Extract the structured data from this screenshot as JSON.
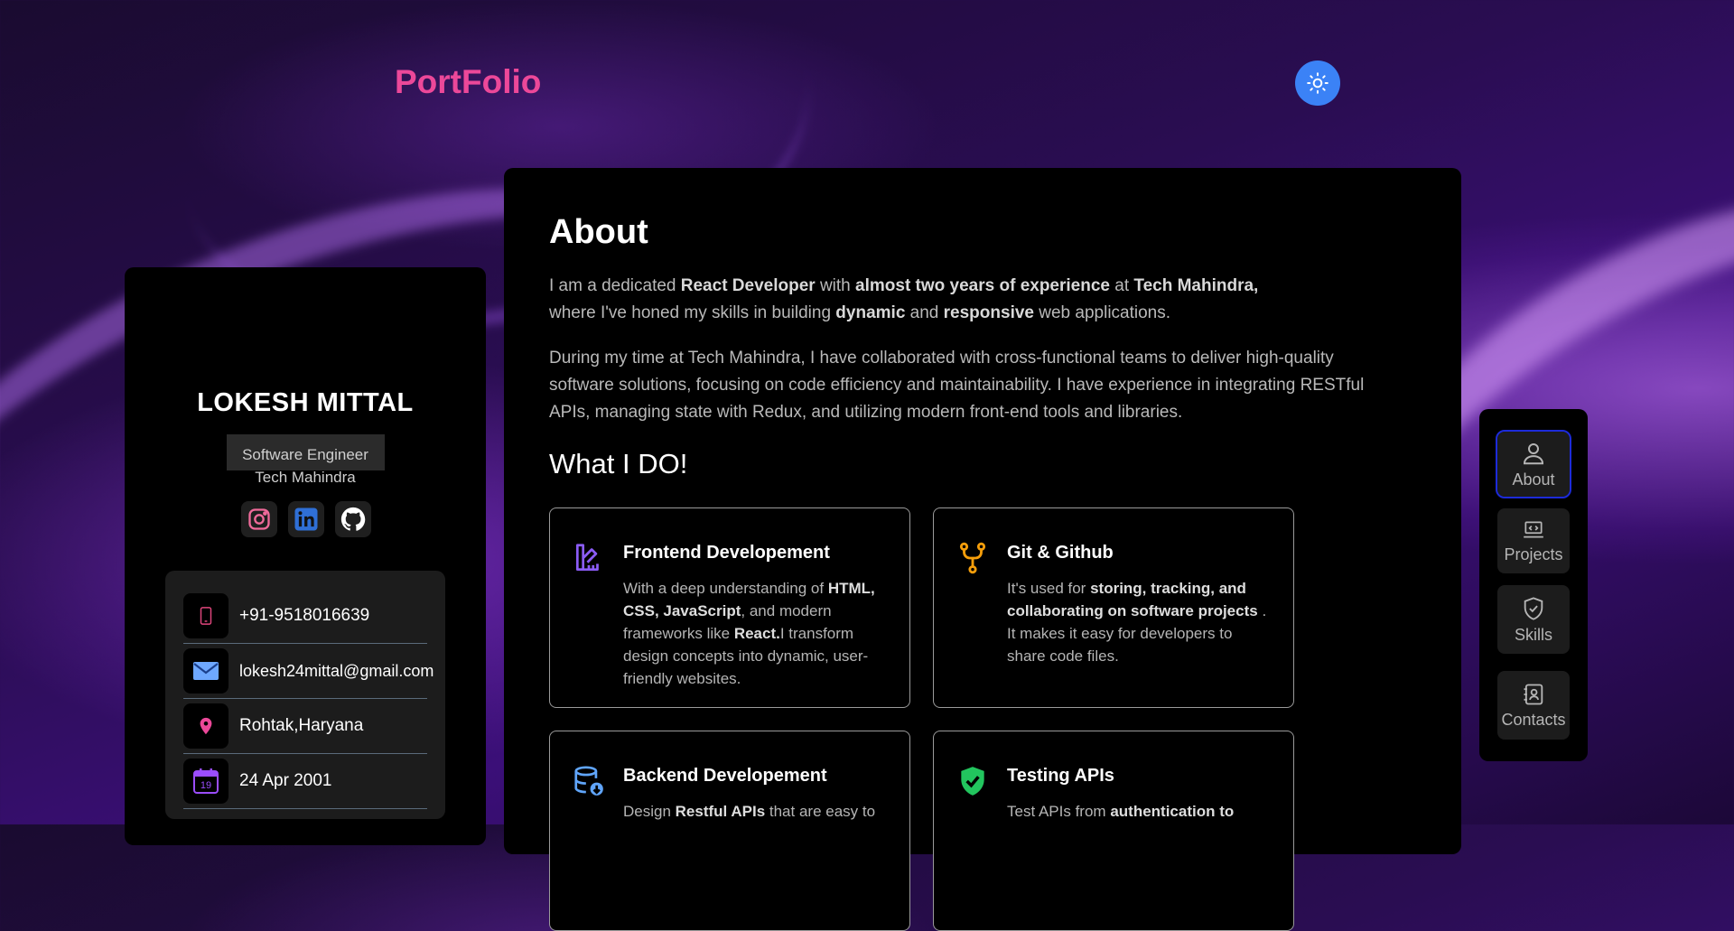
{
  "header": {
    "logo": "PortFolio",
    "theme_toggle_icon": "sun-icon"
  },
  "profile": {
    "name": "LOKESH MITTAL",
    "role": "Software Engineer",
    "company": "Tech Mahindra",
    "socials": [
      "instagram-icon",
      "linkedin-icon",
      "github-icon"
    ],
    "contacts": [
      {
        "icon": "phone-icon",
        "value": "+91-9518016639"
      },
      {
        "icon": "mail-icon",
        "value": "lokesh24mittal@gmail.com"
      },
      {
        "icon": "location-icon",
        "value": "Rohtak,Haryana"
      },
      {
        "icon": "calendar-icon",
        "value": "24 Apr 2001",
        "calendar_day": "19"
      }
    ]
  },
  "about": {
    "title": "About",
    "p1": {
      "t1": "I am a dedicated ",
      "b1": "React Developer",
      "t2": " with ",
      "b2": "almost two years of experience",
      "t3": " at ",
      "b3": "Tech Mahindra,",
      "t4": "where I've honed my skills in building ",
      "b4": "dynamic",
      "t5": " and ",
      "b5": "responsive",
      "t6": " web applications."
    },
    "p2": "During my time at Tech Mahindra, I have collaborated with cross-functional teams to deliver high-quality software solutions, focusing on code efficiency and maintainability. I have experience in integrating RESTful APIs, managing state with Redux, and utilizing modern front-end tools and libraries.",
    "what_title": "What I DO!",
    "cards": [
      {
        "title": "Frontend Developement",
        "t1": "With a deep understanding of ",
        "b1": "HTML, CSS, JavaScript",
        "t2": ", and modern frameworks like ",
        "b2": "React.",
        "t3": "I transform design concepts into dynamic, user-friendly websites."
      },
      {
        "title": "Git & Github",
        "t1": "It's used for ",
        "b1": "storing, tracking, and collaborating on software projects",
        "t2": " . It makes it easy for developers to share code files."
      },
      {
        "title": "Backend Developement",
        "t1": "Design ",
        "b1": "Restful APIs",
        "t2": " that are easy to"
      },
      {
        "title": "Testing APIs",
        "t1": "Test APIs from ",
        "b1": "authentication to"
      }
    ]
  },
  "nav": {
    "items": [
      {
        "label": "About",
        "icon": "user-icon",
        "active": true
      },
      {
        "label": "Projects",
        "icon": "laptop-code-icon"
      },
      {
        "label": "Skills",
        "icon": "shield-check-icon"
      },
      {
        "label": "Contacts",
        "icon": "contact-book-icon"
      }
    ]
  },
  "colors": {
    "accent_pink": "#ec4899",
    "theme_button": "#3b82f6",
    "panel": "#000000"
  }
}
